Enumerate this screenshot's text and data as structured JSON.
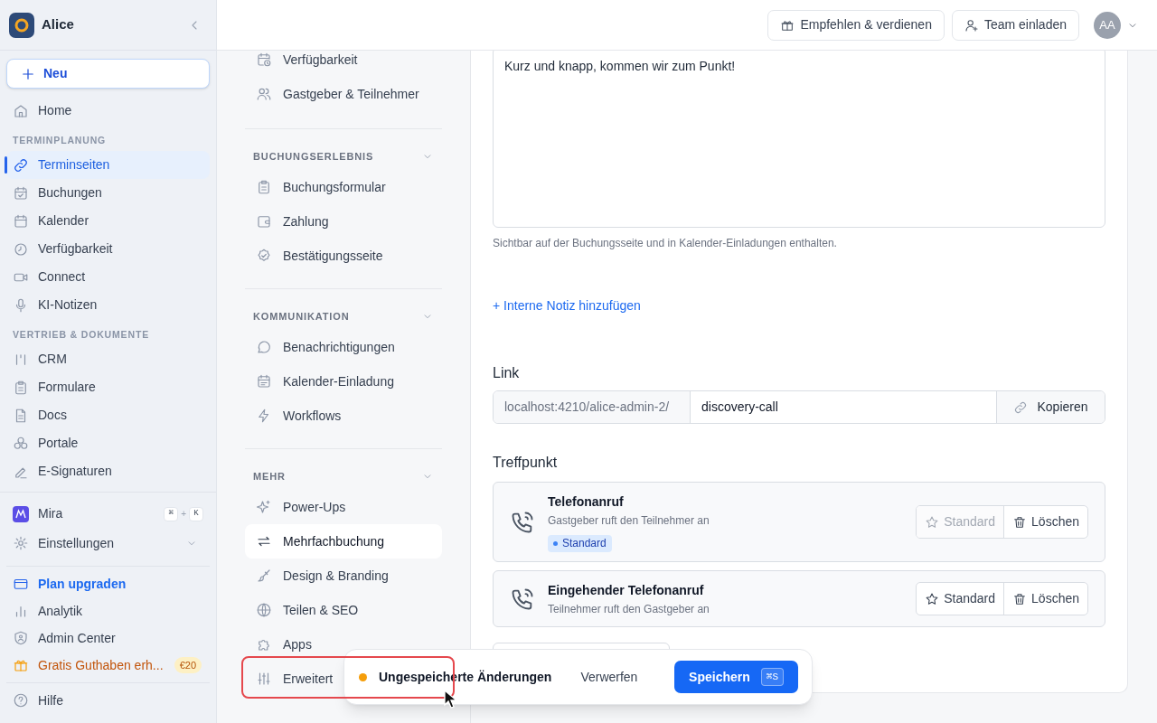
{
  "sidebar": {
    "workspace": "Alice",
    "new_button": "Neu",
    "groups": [
      {
        "items": [
          {
            "label": "Home",
            "selected": false
          }
        ]
      },
      {
        "heading": "TERMINPLANUNG",
        "items": [
          {
            "label": "Terminseiten",
            "selected": true
          },
          {
            "label": "Buchungen",
            "selected": false
          },
          {
            "label": "Kalender",
            "selected": false
          },
          {
            "label": "Verfügbarkeit",
            "selected": false
          },
          {
            "label": "Connect",
            "selected": false
          },
          {
            "label": "KI-Notizen",
            "selected": false
          }
        ]
      },
      {
        "heading": "VERTRIEB & DOKUMENTE",
        "items": [
          {
            "label": "CRM",
            "selected": false
          },
          {
            "label": "Formulare",
            "selected": false
          },
          {
            "label": "Docs",
            "selected": false
          },
          {
            "label": "Portale",
            "selected": false
          },
          {
            "label": "E-Signaturen",
            "selected": false
          }
        ]
      }
    ],
    "bottom": [
      {
        "kind": "assistant",
        "label": "Mira",
        "keys": [
          "⌘",
          "+",
          "K"
        ]
      },
      {
        "kind": "expandable",
        "label": "Einstellungen",
        "expanded": false
      },
      {
        "kind": "divider"
      },
      {
        "kind": "upgrade",
        "label": "Plan upgraden"
      },
      {
        "kind": "plain",
        "label": "Analytik"
      },
      {
        "kind": "plain",
        "label": "Admin Center"
      },
      {
        "kind": "promo",
        "label": "Gratis Guthaben erh...",
        "badge": "€20"
      },
      {
        "kind": "divider"
      },
      {
        "kind": "plain",
        "label": "Hilfe"
      }
    ]
  },
  "top_bar": {
    "buttons": [
      "Empfehlen & verdienen",
      "Team einladen"
    ],
    "avatar": "AA"
  },
  "settings_nav": {
    "sections": [
      {
        "items": [
          {
            "label": "Verfügbarkeit",
            "selected": false
          },
          {
            "label": "Gastgeber & Teilnehmer",
            "selected": false
          }
        ]
      },
      {
        "heading": "BUCHUNGSERLEBNIS",
        "expanded": true,
        "items": [
          {
            "label": "Buchungsformular",
            "selected": false
          },
          {
            "label": "Zahlung",
            "selected": false
          },
          {
            "label": "Bestätigungsseite",
            "selected": false
          }
        ]
      },
      {
        "heading": "KOMMUNIKATION",
        "expanded": true,
        "items": [
          {
            "label": "Benachrichtigungen",
            "selected": false
          },
          {
            "label": "Kalender-Einladung",
            "selected": false
          },
          {
            "label": "Workflows",
            "selected": false
          }
        ]
      },
      {
        "heading": "MEHR",
        "expanded": true,
        "items": [
          {
            "label": "Power-Ups",
            "selected": false
          },
          {
            "label": "Mehrfachbuchung",
            "selected": true
          },
          {
            "label": "Design & Branding",
            "selected": false
          },
          {
            "label": "Teilen & SEO",
            "selected": false
          },
          {
            "label": "Apps",
            "selected": false
          },
          {
            "label": "Erweitert",
            "selected": false
          }
        ]
      }
    ]
  },
  "form": {
    "description": "Kurz und knapp, kommen wir zum Punkt!",
    "description_help": "Sichtbar auf der Buchungsseite und in Kalender-Einladungen enthalten.",
    "add_note_link": "+ Interne Notiz hinzufügen",
    "link": {
      "label": "Link",
      "prefix": "localhost:4210/alice-admin-2/",
      "slug": "discovery-call",
      "copy_button": "Kopieren"
    },
    "location": {
      "label": "Treffpunkt",
      "options": [
        {
          "title": "Telefonanruf",
          "subtitle": "Gastgeber ruft den Teilnehmer an",
          "is_default": true,
          "default_badge": "Standard",
          "default_button": "Standard",
          "delete_button": "Löschen"
        },
        {
          "title": "Eingehender Telefonanruf",
          "subtitle": "Teilnehmer ruft den Gastgeber an",
          "is_default": false,
          "default_button": "Standard",
          "delete_button": "Löschen"
        }
      ]
    }
  },
  "unsaved_bar": {
    "message": "Ungespeicherte Änderungen",
    "discard": "Verwerfen",
    "save": "Speichern",
    "shortcut": "⌘S"
  }
}
